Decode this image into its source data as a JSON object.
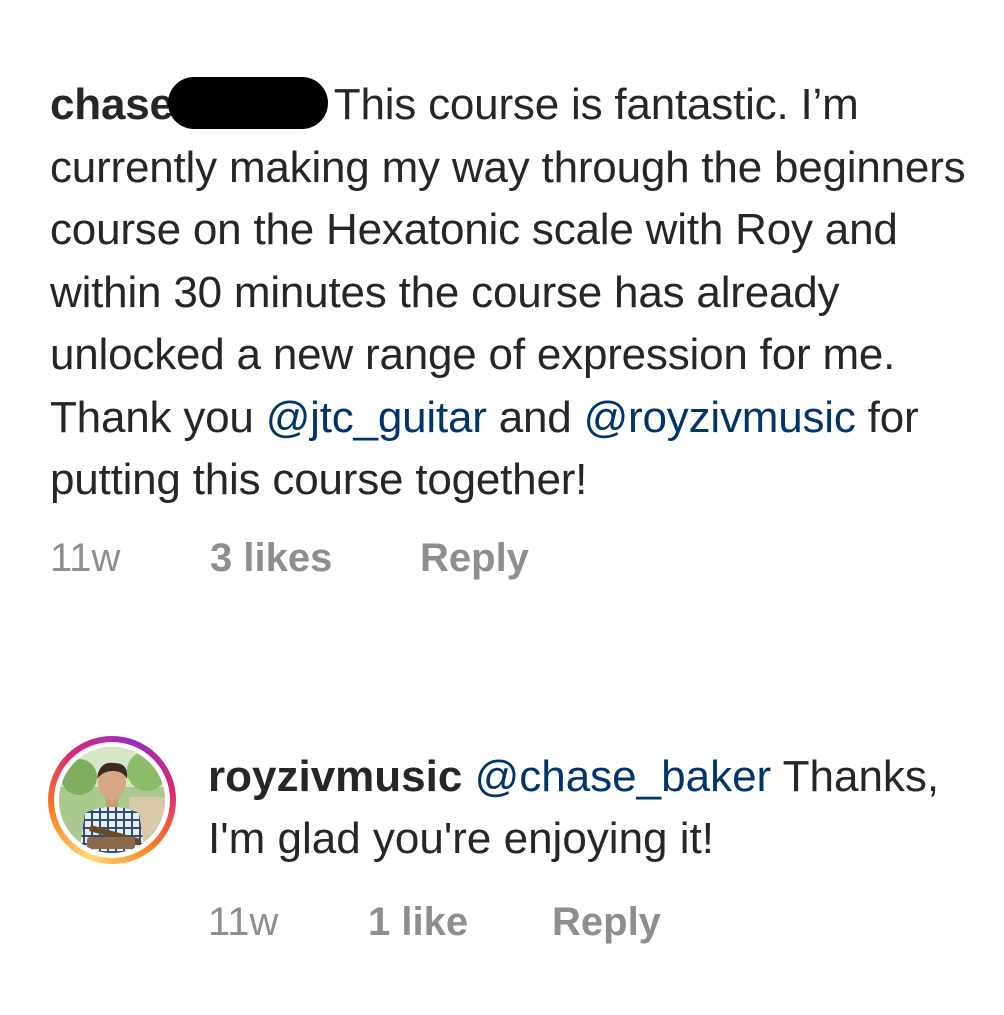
{
  "comment": {
    "username": "chase",
    "text_first": "This course is fantastic. I’m currently making my way through the beginners course on the Hexatonic scale with Roy and within 30 minutes the course has already unlocked a new range of expression for me. Thank you ",
    "mention_1": "@jtc_guitar",
    "text_and": " and ",
    "mention_2": "@royzivmusic",
    "text_end": " for putting this course together!",
    "time": "11w",
    "likes": "3 likes",
    "reply_label": "Reply"
  },
  "reply": {
    "username": "royzivmusic",
    "mention": "@chase_baker",
    "text": "Thanks, I'm glad you're enjoying it!",
    "time": "11w",
    "likes": "1 like",
    "reply_label": "Reply"
  },
  "colors": {
    "text": "#262626",
    "muted": "#8e8e8e",
    "mention": "#003569"
  }
}
